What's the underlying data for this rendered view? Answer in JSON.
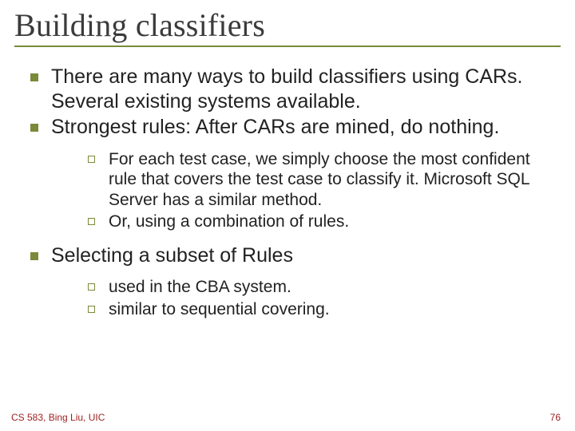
{
  "title": "Building classifiers",
  "bullets": {
    "b1": "There are many ways to build classifiers using CARs. Several existing systems available.",
    "b2": "Strongest rules: After CARs are mined, do nothing.",
    "b2_sub": {
      "s1": "For each test case, we simply choose the most confident rule that covers the test case to classify it. Microsoft SQL Server has a similar method.",
      "s2": "Or, using a combination of rules."
    },
    "b3": "Selecting a subset of Rules",
    "b3_sub": {
      "s1": "used in the CBA system.",
      "s2": "similar to sequential covering."
    }
  },
  "footer": {
    "left": "CS 583, Bing Liu, UIC",
    "page": "76"
  }
}
